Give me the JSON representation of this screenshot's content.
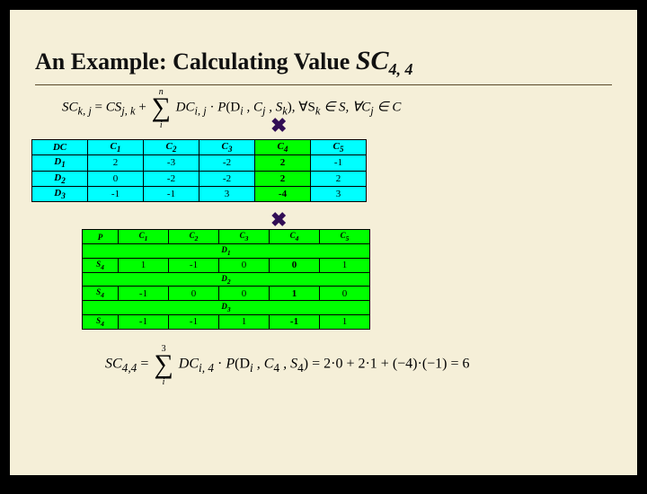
{
  "title": {
    "prefix": "An Example: Calculating Value ",
    "sc": "SC",
    "sub": "4, 4"
  },
  "formula1": {
    "lhs": "SC",
    "lhs_sub": "k, j",
    "eq": " = ",
    "cs": "CS",
    "cs_sub": "j, k",
    "plus": " + ",
    "sig_top": "n",
    "sig_bot": "i",
    "dc": "DC",
    "dc_sub": "i, j",
    "dot1": " · ",
    "p": "P",
    "p_args": "(D",
    "di_sub": "i",
    "comma1": " , C",
    "cj_sub": "j",
    "comma2": " , S",
    "sk_sub": "k",
    "close": "), ∀S",
    "sk2_sub": "k",
    "in1": " ∈ S, ∀C",
    "cj2_sub": "j",
    "in2": " ∈ C"
  },
  "table1": {
    "headers": [
      "DC",
      "C",
      "C",
      "C",
      "C",
      "C"
    ],
    "header_subs": [
      "",
      "1",
      "2",
      "3",
      "4",
      "5"
    ],
    "rows": [
      {
        "label": "D",
        "sub": "1",
        "cells": [
          "2",
          "-3",
          "-2",
          "2",
          "-1"
        ]
      },
      {
        "label": "D",
        "sub": "2",
        "cells": [
          "0",
          "-2",
          "-2",
          "2",
          "2"
        ]
      },
      {
        "label": "D",
        "sub": "3",
        "cells": [
          "-1",
          "-1",
          "3",
          "-4",
          "3"
        ]
      }
    ],
    "hl_col": 3
  },
  "table2": {
    "corner": "P",
    "col_headers": [
      "C",
      "C",
      "C",
      "C",
      "C"
    ],
    "col_subs": [
      "1",
      "2",
      "3",
      "4",
      "5"
    ],
    "groups": [
      {
        "d": "D",
        "dsub": "1",
        "rowlabel": "S",
        "rowsub": "4",
        "cells": [
          "1",
          "-1",
          "0",
          "0",
          "1"
        ]
      },
      {
        "d": "D",
        "dsub": "2",
        "rowlabel": "S",
        "rowsub": "4",
        "cells": [
          "-1",
          "0",
          "0",
          "1",
          "0"
        ]
      },
      {
        "d": "D",
        "dsub": "3",
        "rowlabel": "S",
        "rowsub": "4",
        "cells": [
          "-1",
          "-1",
          "1",
          "-1",
          "1"
        ]
      }
    ],
    "hl_col": 3
  },
  "formula2": {
    "lhs": "SC",
    "lhs_sub": "4,4",
    "eq": " = ",
    "sig_top": "3",
    "sig_bot": "i",
    "dc": "DC",
    "dc_sub": "i, 4",
    "dot": " · ",
    "p": "P",
    "p_args": "(D",
    "di_sub": "i",
    "comma1": " , C",
    "c4": "4",
    "comma2": " , S",
    "s4": "4",
    "close": ") =",
    "rhs": "2·0 + 2·1 + (−4)·(−1) = 6"
  },
  "cross": "✖"
}
